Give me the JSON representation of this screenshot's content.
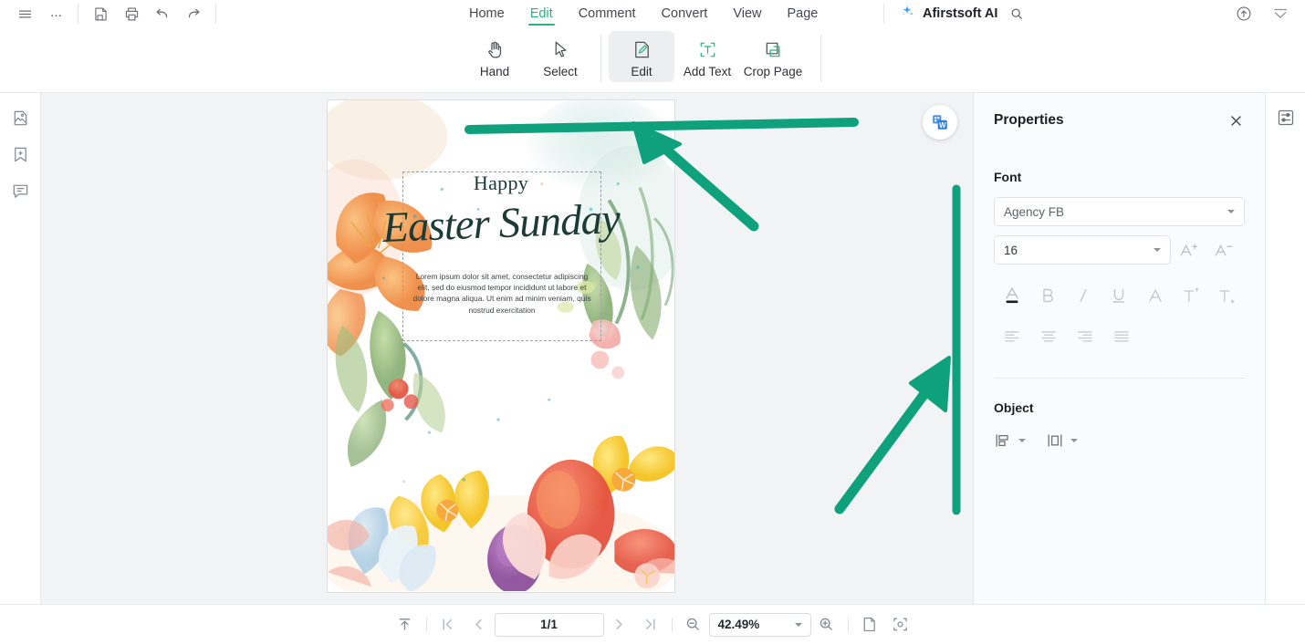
{
  "topbar": {
    "left_icons": [
      {
        "name": "menu-icon",
        "title": "Menu"
      },
      {
        "name": "more-icon",
        "title": "More"
      },
      {
        "name": "save-icon",
        "title": "Save"
      },
      {
        "name": "print-icon",
        "title": "Print"
      },
      {
        "name": "undo-icon",
        "title": "Undo"
      },
      {
        "name": "redo-icon",
        "title": "Redo"
      }
    ],
    "tabs": [
      {
        "label": "Home",
        "active": false
      },
      {
        "label": "Edit",
        "active": true
      },
      {
        "label": "Comment",
        "active": false
      },
      {
        "label": "Convert",
        "active": false
      },
      {
        "label": "View",
        "active": false
      },
      {
        "label": "Page",
        "active": false
      }
    ],
    "ai_label": "Afirstsoft AI",
    "search_icon": "search-icon",
    "right_icons": [
      {
        "name": "cloud-upload-icon"
      },
      {
        "name": "collapse-ribbon-icon"
      }
    ]
  },
  "ribbon": {
    "tools": [
      {
        "label": "Hand",
        "icon": "hand-icon",
        "active": false
      },
      {
        "label": "Select",
        "icon": "cursor-icon",
        "active": false
      },
      {
        "label": "Edit",
        "icon": "edit-pencil-icon",
        "active": true
      },
      {
        "label": "Add Text",
        "icon": "add-text-icon",
        "active": false
      },
      {
        "label": "Crop Page",
        "icon": "crop-icon",
        "active": false
      }
    ]
  },
  "left_rail": {
    "items": [
      {
        "name": "thumbnails-icon"
      },
      {
        "name": "bookmark-add-icon"
      },
      {
        "name": "comment-icon"
      }
    ]
  },
  "document": {
    "heading": "Happy",
    "script_title": "Easter Sunday",
    "body": "Lorem ipsum dolor sit amet, consectetur adipiscing elit, sed do eiusmod tempor incididunt ut labore et dolore magna aliqua. Ut enim ad minim veniam, quis nostrud exercitation",
    "convert_fab": "convert-to-word-icon",
    "colors": {
      "text_dark": "#1d3b35",
      "orange": "#f29b54",
      "yellow": "#f6ce3c",
      "pink": "#f6b6b2",
      "purple": "#9b5fa8",
      "green_leaf": "#8fb87a",
      "blue_pale": "#bcd7e8",
      "red": "#e8594b"
    }
  },
  "annotations": {
    "color": "#0fa07c",
    "shapes": [
      {
        "name": "horizontal-line-annotation"
      },
      {
        "name": "arrow-annotation-top"
      },
      {
        "name": "vertical-line-annotation"
      },
      {
        "name": "arrow-annotation-right"
      }
    ]
  },
  "properties": {
    "title": "Properties",
    "close_icon": "close-icon",
    "font": {
      "section_label": "Font",
      "family_value": "Agency FB",
      "family_placeholder": "Agency FB",
      "size_value": "16",
      "increase_icon": "increase-font-size-icon",
      "decrease_icon": "decrease-font-size-icon",
      "format_buttons": [
        {
          "name": "font-color-icon",
          "label": "A"
        },
        {
          "name": "bold-icon",
          "label": "B"
        },
        {
          "name": "italic-icon",
          "label": "I"
        },
        {
          "name": "underline-icon",
          "label": "U"
        },
        {
          "name": "strikethrough-icon",
          "label": "A"
        },
        {
          "name": "superscript-icon",
          "label": "T"
        },
        {
          "name": "subscript-icon",
          "label": "T"
        }
      ],
      "align_buttons": [
        {
          "name": "align-left-icon"
        },
        {
          "name": "align-center-icon"
        },
        {
          "name": "align-right-icon"
        },
        {
          "name": "align-justify-icon"
        }
      ]
    },
    "object": {
      "section_label": "Object",
      "buttons": [
        {
          "name": "object-align-icon"
        },
        {
          "name": "object-distribute-icon"
        }
      ]
    }
  },
  "right_rail": {
    "items": [
      {
        "name": "panel-settings-icon"
      }
    ]
  },
  "bottombar": {
    "scroll_top_icon": "scroll-to-top-icon",
    "first_page_icon": "first-page-icon",
    "prev_page_icon": "previous-page-icon",
    "page_value": "1/1",
    "next_page_icon": "next-page-icon",
    "last_page_icon": "last-page-icon",
    "zoom_out_icon": "zoom-out-icon",
    "zoom_value": "42.49%",
    "zoom_in_icon": "zoom-in-icon",
    "fit_page_icon": "fit-page-icon",
    "fit_width_icon": "fit-width-icon"
  }
}
